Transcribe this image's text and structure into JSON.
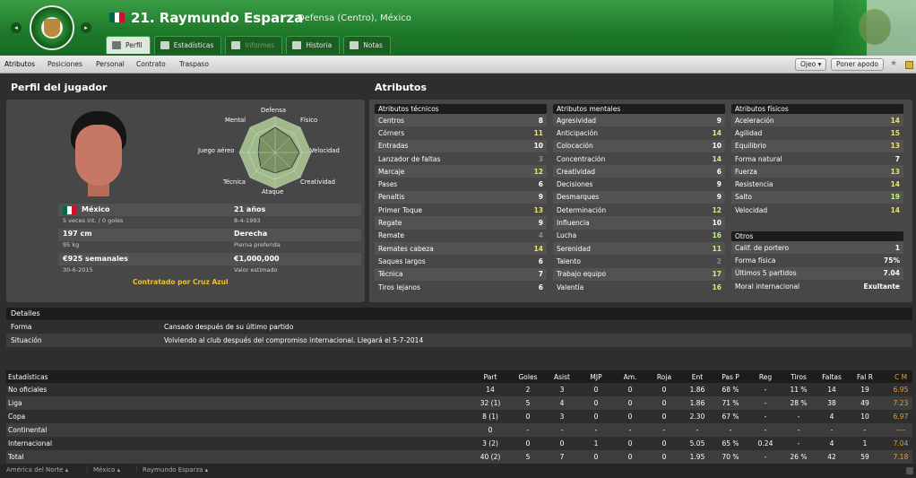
{
  "header": {
    "prev": "◂",
    "next": "▸",
    "player_name": "21. Raymundo Esparza",
    "subtitle": "Defensa (Centro), México",
    "flag_colors": [
      "#006847",
      "#ffffff",
      "#ce1126"
    ],
    "tabs": [
      {
        "label": "Perfil",
        "icon": "profile-icon",
        "active": true,
        "disabled": false
      },
      {
        "label": "Estadísticas",
        "icon": "stats-icon",
        "active": false,
        "disabled": false
      },
      {
        "label": "Informes",
        "icon": "reports-icon",
        "active": false,
        "disabled": true
      },
      {
        "label": "Historia",
        "icon": "history-icon",
        "active": false,
        "disabled": false
      },
      {
        "label": "Notas",
        "icon": "notes-icon",
        "active": false,
        "disabled": false
      }
    ]
  },
  "subnav": {
    "items": [
      "Atributos",
      "Posiciones",
      "Personal",
      "Contrato",
      "Traspaso"
    ],
    "ojeo": "Ojeo ▾",
    "poner_apodo": "Poner apodo",
    "star": "★"
  },
  "profile": {
    "title": "Perfil del jugador",
    "radar_labels": {
      "defensa": "Defensa",
      "mental": "Mental",
      "fisico": "Físico",
      "juego_aereo": "Juego aéreo",
      "velocidad": "Velocidad",
      "tecnica": "Técnica",
      "creatividad": "Creatividad",
      "ataque": "Ataque"
    },
    "nation": "México",
    "caps": "5 veces int. / 0 goles",
    "age": "21 años",
    "dob": "8-4-1993",
    "height": "197 cm",
    "weight": "95 kg",
    "foot": "Derecha",
    "foot_label": "Pierna preferida",
    "wage": "€925 semanales",
    "contract_end": "30-6-2015",
    "value": "€1,000,000",
    "value_label": "Valor estimado",
    "contracted": "Contratado por Cruz Azul"
  },
  "attributes": {
    "title": "Atributos",
    "tecnicos": {
      "title": "Atributos técnicos",
      "rows": [
        {
          "name": "Centros",
          "value": "8",
          "c": "w"
        },
        {
          "name": "Córners",
          "value": "11",
          "c": "y"
        },
        {
          "name": "Entradas",
          "value": "10",
          "c": "w"
        },
        {
          "name": "Lanzador de faltas",
          "value": "3",
          "c": "d"
        },
        {
          "name": "Marcaje",
          "value": "12",
          "c": "y"
        },
        {
          "name": "Pases",
          "value": "6",
          "c": "w"
        },
        {
          "name": "Penaltis",
          "value": "9",
          "c": "w"
        },
        {
          "name": "Primer Toque",
          "value": "13",
          "c": "y"
        },
        {
          "name": "Regate",
          "value": "9",
          "c": "w"
        },
        {
          "name": "Remate",
          "value": "4",
          "c": "d"
        },
        {
          "name": "Remates cabeza",
          "value": "14",
          "c": "y"
        },
        {
          "name": "Saques largos",
          "value": "6",
          "c": "w"
        },
        {
          "name": "Técnica",
          "value": "7",
          "c": "w"
        },
        {
          "name": "Tiros lejanos",
          "value": "6",
          "c": "w"
        }
      ]
    },
    "mentales": {
      "title": "Atributos mentales",
      "rows": [
        {
          "name": "Agresividad",
          "value": "9",
          "c": "w"
        },
        {
          "name": "Anticipación",
          "value": "14",
          "c": "y"
        },
        {
          "name": "Colocación",
          "value": "10",
          "c": "w"
        },
        {
          "name": "Concentración",
          "value": "14",
          "c": "y"
        },
        {
          "name": "Creatividad",
          "value": "6",
          "c": "w"
        },
        {
          "name": "Decisiones",
          "value": "9",
          "c": "w"
        },
        {
          "name": "Desmarques",
          "value": "9",
          "c": "w"
        },
        {
          "name": "Determinación",
          "value": "12",
          "c": "y"
        },
        {
          "name": "Influencia",
          "value": "10",
          "c": "w"
        },
        {
          "name": "Lucha",
          "value": "16",
          "c": "g"
        },
        {
          "name": "Serenidad",
          "value": "11",
          "c": "y"
        },
        {
          "name": "Talento",
          "value": "2",
          "c": "d"
        },
        {
          "name": "Trabajo equipo",
          "value": "17",
          "c": "g"
        },
        {
          "name": "Valentía",
          "value": "16",
          "c": "g"
        }
      ]
    },
    "fisicos": {
      "title": "Atributos físicos",
      "rows": [
        {
          "name": "Aceleración",
          "value": "14",
          "c": "y"
        },
        {
          "name": "Agilidad",
          "value": "15",
          "c": "y"
        },
        {
          "name": "Equilibrio",
          "value": "13",
          "c": "y"
        },
        {
          "name": "Forma natural",
          "value": "7",
          "c": "w"
        },
        {
          "name": "Fuerza",
          "value": "13",
          "c": "y"
        },
        {
          "name": "Resistencia",
          "value": "14",
          "c": "y"
        },
        {
          "name": "Salto",
          "value": "19",
          "c": "g"
        },
        {
          "name": "Velocidad",
          "value": "14",
          "c": "y"
        }
      ]
    },
    "otros": {
      "title": "Otros",
      "rows": [
        {
          "name": "Calif. de portero",
          "value": "1"
        },
        {
          "name": "Forma física",
          "value": "75%"
        },
        {
          "name": "Últimos 5 partidos",
          "value": "7.04"
        },
        {
          "name": "Moral internacional",
          "value": "Exultante"
        }
      ]
    }
  },
  "details": {
    "title": "Detalles",
    "rows": [
      {
        "k": "Forma",
        "v": "Cansado después de su último partido"
      },
      {
        "k": "Situación",
        "v": "Volviendo al club después del compromiso internacional. Llegará el 5-7-2014"
      }
    ]
  },
  "stats": {
    "headers": [
      "Estadísticas",
      "Part",
      "Goles",
      "Asist",
      "MJP",
      "Am.",
      "Roja",
      "Ent",
      "Pas P",
      "Reg",
      "Tiros",
      "Faltas",
      "Fal R",
      "C M"
    ],
    "rows": [
      [
        "No oficiales",
        "14",
        "2",
        "3",
        "0",
        "0",
        "0",
        "1.86",
        "68 %",
        "-",
        "11 %",
        "14",
        "19",
        "6.95"
      ],
      [
        "Liga",
        "32 (1)",
        "5",
        "4",
        "0",
        "0",
        "0",
        "1.86",
        "71 %",
        "-",
        "28 %",
        "38",
        "49",
        "7.23"
      ],
      [
        "Copa",
        "8 (1)",
        "0",
        "3",
        "0",
        "0",
        "0",
        "2.30",
        "67 %",
        "-",
        "-",
        "4",
        "10",
        "6.97"
      ],
      [
        "Continental",
        "0",
        "-",
        "-",
        "-",
        "-",
        "-",
        "-",
        "-",
        "-",
        "-",
        "-",
        "-",
        "----"
      ],
      [
        "Internacional",
        "3 (2)",
        "0",
        "0",
        "1",
        "0",
        "0",
        "5.05",
        "65 %",
        "0.24",
        "-",
        "4",
        "1",
        "7.04"
      ],
      [
        "Total",
        "40 (2)",
        "5",
        "7",
        "0",
        "0",
        "0",
        "1.95",
        "70 %",
        "-",
        "26 %",
        "42",
        "59",
        "7.18"
      ]
    ]
  },
  "footer": {
    "crumbs": [
      "América del Norte ▴",
      "México ▴",
      "Raymundo Esparza ▴"
    ]
  }
}
